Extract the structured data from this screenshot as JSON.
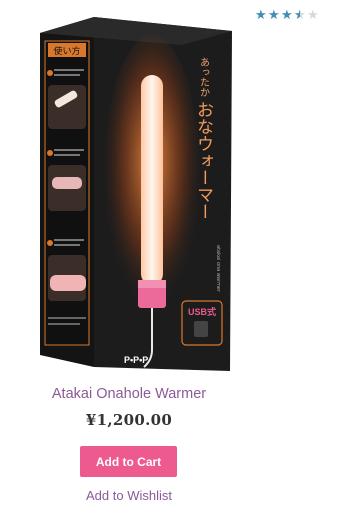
{
  "rating": {
    "value": 3.5,
    "max": 5,
    "color": "#3f8fb5"
  },
  "product": {
    "title": "Atakai Onahole Warmer",
    "price": "¥1,200.00",
    "add_to_cart_label": "Add to Cart",
    "add_to_wishlist_label": "Add to Wishlist"
  },
  "packaging": {
    "brand_text": "あったか",
    "product_name_text": "おなウォーマー",
    "romaji_text": "atakai ona warmer",
    "instructions_header": "使い方",
    "usb_label": "USB式",
    "logo_text": "P•P•P"
  },
  "colors": {
    "accent": "#ec5a8f",
    "link": "#8a5a98",
    "box": "#1a1a1a",
    "glow": "#ff7a2a"
  }
}
